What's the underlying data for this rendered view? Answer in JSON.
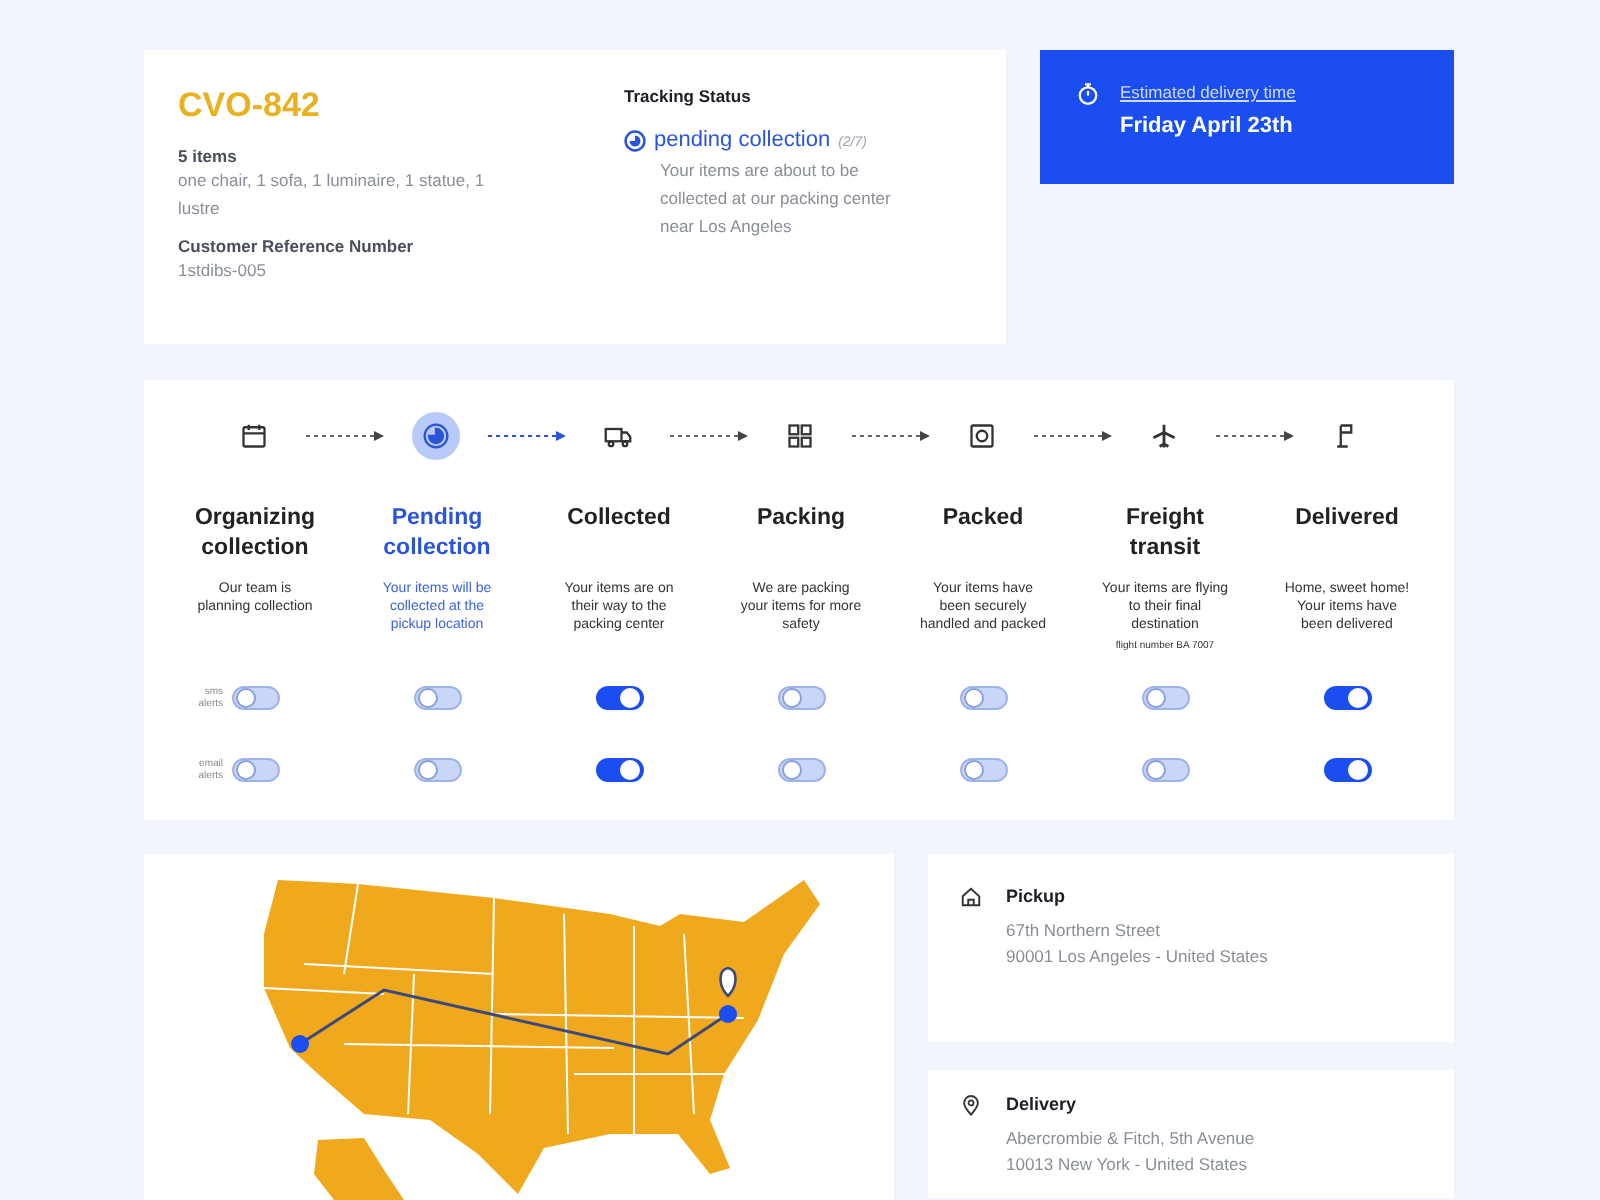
{
  "order": {
    "code": "CVO-842",
    "items_title": "5 items",
    "items_text": "one chair, 1 sofa, 1 luminaire, 1 statue, 1 lustre",
    "reference_label": "Customer Reference Number",
    "reference": "1stdibs-005"
  },
  "tracking": {
    "title": "Tracking Status",
    "status": "pending collection",
    "progress": "(2/7)",
    "text": "Your items are about to be collected at our packing center near Los Angeles"
  },
  "delivery_estimate": {
    "label": "Estimated delivery time",
    "date": "Friday April 23th"
  },
  "alert_labels": [
    "sms alerts",
    "email alerts"
  ],
  "steps": [
    {
      "title": "Organizing collection",
      "text": "Our team is planning  collection",
      "selected": false,
      "alerts": [
        false,
        false
      ]
    },
    {
      "title": "Pending collection",
      "text": "Your items will be collected at the pickup location",
      "selected": true,
      "alerts": [
        false,
        false
      ]
    },
    {
      "title": "Collected",
      "text": "Your items are on their way to the packing center",
      "selected": false,
      "alerts": [
        true,
        true
      ]
    },
    {
      "title": "Packing",
      "text": "We are packing your items for more safety",
      "selected": false,
      "alerts": [
        false,
        false
      ]
    },
    {
      "title": "Packed",
      "text": "Your items have been securely handled and packed",
      "selected": false,
      "alerts": [
        false,
        false
      ]
    },
    {
      "title": "Freight transit",
      "text": "Your items are flying to their final destination",
      "note": "flight number BA 7007",
      "selected": false,
      "alerts": [
        false,
        false
      ]
    },
    {
      "title": "Delivered",
      "text": "Home, sweet home! Your items have been delivered",
      "selected": false,
      "alerts": [
        true,
        true
      ]
    }
  ],
  "addresses": [
    {
      "kind": "pickup",
      "title": "Pickup",
      "lines": [
        "67th Northern Street",
        "90001 Los Angeles - United States"
      ]
    },
    {
      "kind": "delivery",
      "title": "Delivery",
      "lines": [
        "Abercrombie & Fitch, 5th Avenue",
        "10013 New York - United States"
      ]
    }
  ]
}
